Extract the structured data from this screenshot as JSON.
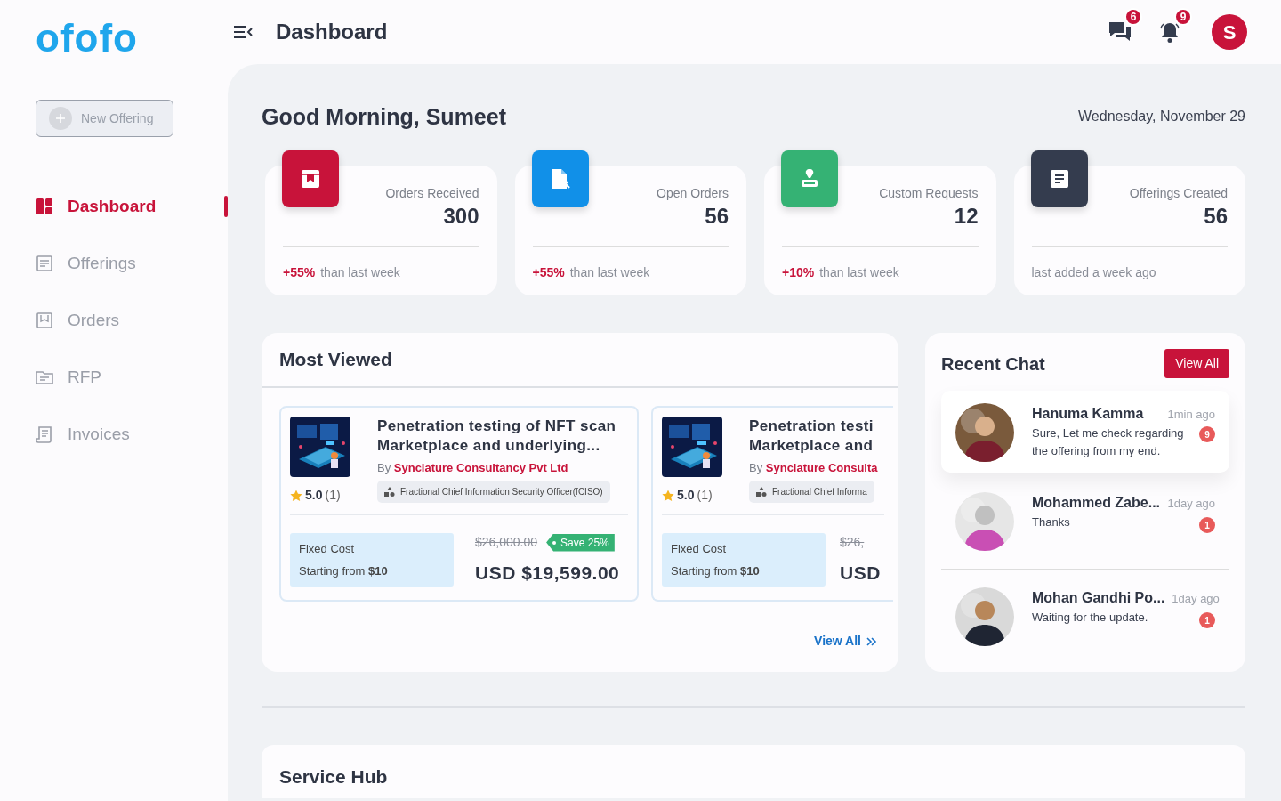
{
  "brand": {
    "logo": "ofofo"
  },
  "sidebar": {
    "new_button": "New Offering",
    "items": [
      {
        "label": "Dashboard",
        "kind": "grid",
        "selected": true
      },
      {
        "label": "Offerings",
        "kind": "doc",
        "selected": false
      },
      {
        "label": "Orders",
        "kind": "box",
        "selected": false
      },
      {
        "label": "RFP",
        "kind": "folder",
        "selected": false
      },
      {
        "label": "Invoices",
        "kind": "receipt",
        "selected": false
      }
    ]
  },
  "header": {
    "title": "Dashboard",
    "messages_count": "6",
    "notifications_count": "9",
    "avatar_initial": "S"
  },
  "greeting": "Good Morning, Sumeet",
  "date": "Wednesday, November 29",
  "stats": [
    {
      "kind": "orders",
      "color": "#c8133a",
      "label": "Orders Received",
      "value": "300",
      "change": "+55%",
      "note": "than last week"
    },
    {
      "kind": "open",
      "color": "#1190e8",
      "label": "Open Orders",
      "value": "56",
      "change": "+55%",
      "note": "than last week"
    },
    {
      "kind": "custom",
      "color": "#35b274",
      "label": "Custom Requests",
      "value": "12",
      "change": "+10%",
      "note": "than last week"
    },
    {
      "kind": "offerings",
      "color": "#343c4e",
      "label": "Offerings Created",
      "value": "56",
      "note": "last added a week ago"
    }
  ],
  "most_viewed": {
    "title": "Most Viewed",
    "view_all": "View All",
    "offerings": [
      {
        "title_lines": [
          "Penetration testing of NFT scan",
          "Marketplace and underlying..."
        ],
        "by": "By",
        "vendor": "Synclature Consultancy Pvt Ltd",
        "category": "Fractional Chief Information Security Officer(fCISO)",
        "rating": "5.0",
        "reviews": "(1)",
        "cost_type": "Fixed Cost",
        "starting_label": "Starting from",
        "starting_price": "$10",
        "old_price": "$26,000.00",
        "save": "Save 25%",
        "price": "USD $19,599.00"
      },
      {
        "title_lines": [
          "Penetration testi",
          "Marketplace and"
        ],
        "by": "By",
        "vendor": "Synclature Consulta",
        "category": "Fractional Chief Informa",
        "rating": "5.0",
        "reviews": "(1)",
        "cost_type": "Fixed Cost",
        "starting_label": "Starting from",
        "starting_price": "$10",
        "old_price": "$26,",
        "price": "USD"
      }
    ]
  },
  "recent_chat": {
    "title": "Recent Chat",
    "view_all": "View All",
    "chats": [
      {
        "name": "Hanuma Kamma",
        "time": "1min ago",
        "message": "Sure, Let me check regarding the offering from my end.",
        "unread": "9",
        "selected": true
      },
      {
        "name": "Mohammed Zabe...",
        "time": "1day ago",
        "message": "Thanks",
        "unread": "1",
        "selected": false
      },
      {
        "name": "Mohan Gandhi Po...",
        "time": "1day ago",
        "message": "Waiting for the update.",
        "unread": "1",
        "selected": false
      }
    ]
  },
  "service_hub": {
    "title": "Service Hub"
  }
}
